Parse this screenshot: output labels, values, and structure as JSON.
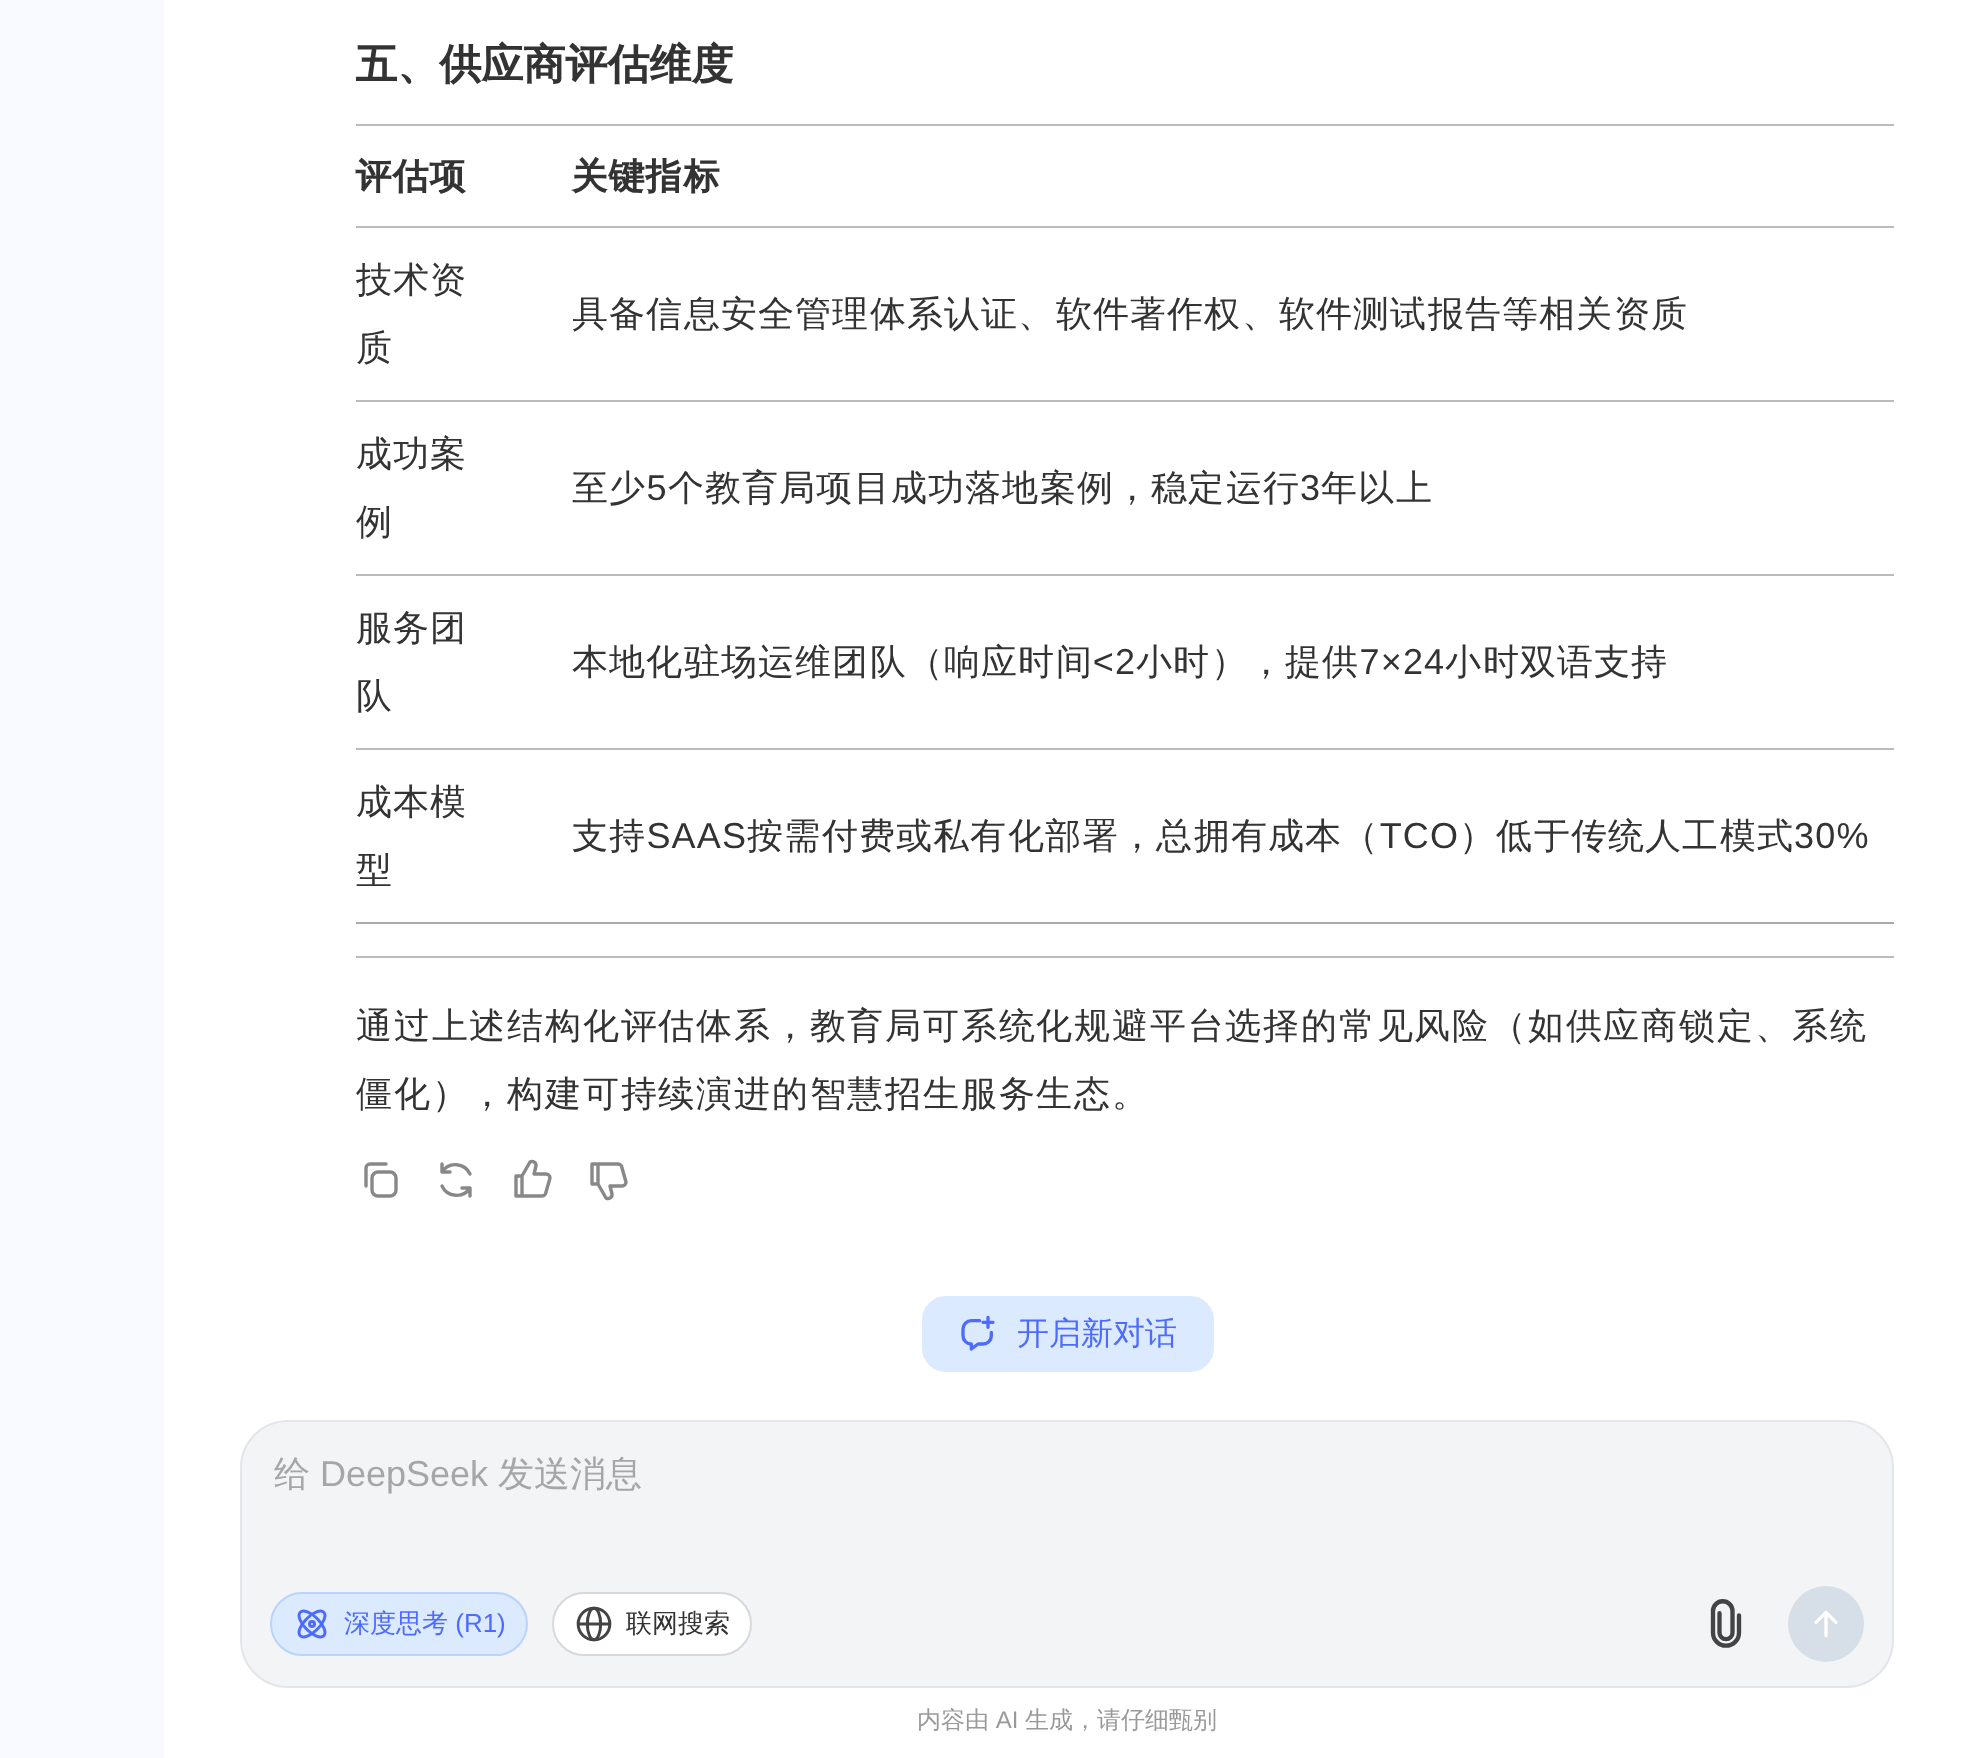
{
  "heading": "五、供应商评估维度",
  "table": {
    "columns": [
      "评估项",
      "关键指标"
    ],
    "rows": [
      {
        "item": "技术资质",
        "indicator": "具备信息安全管理体系认证、软件著作权、软件测试报告等相关资质"
      },
      {
        "item": "成功案例",
        "indicator": "至少5个教育局项目成功落地案例，稳定运行3年以上"
      },
      {
        "item": "服务团队",
        "indicator": "本地化驻场运维团队（响应时间<2小时），提供7×24小时双语支持"
      },
      {
        "item": "成本模型",
        "indicator": "支持SAAS按需付费或私有化部署，总拥有成本（TCO）低于传统人工模式30%"
      }
    ]
  },
  "summary": "通过上述结构化评估体系，教育局可系统化规避平台选择的常见风险（如供应商锁定、系统僵化），构建可持续演进的智慧招生服务生态。",
  "actions": [
    {
      "kind": "copy"
    },
    {
      "kind": "regenerate"
    },
    {
      "kind": "like"
    },
    {
      "kind": "dislike"
    }
  ],
  "new_chat": "开启新对话",
  "composer": {
    "placeholder": "给 DeepSeek 发送消息",
    "toggles": [
      {
        "kind": "think",
        "label": "深度思考 (R1)",
        "selected": true
      },
      {
        "kind": "web",
        "label": "联网搜索",
        "selected": false
      }
    ],
    "send_disabled": true
  },
  "footer": "内容由 AI 生成，请仔细甄别"
}
